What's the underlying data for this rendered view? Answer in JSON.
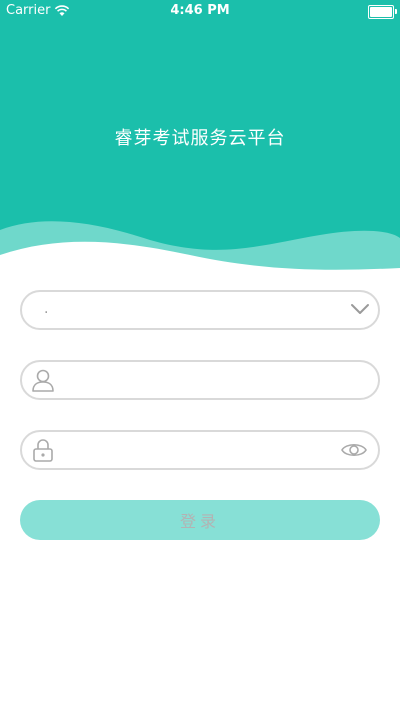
{
  "status_bar": {
    "carrier": "Carrier",
    "time": "4:46 PM"
  },
  "app": {
    "title": "睿芽考试服务云平台"
  },
  "form": {
    "school_select": {
      "value": "."
    },
    "username": {
      "value": ""
    },
    "password": {
      "value": ""
    },
    "login_label": "登录"
  },
  "colors": {
    "brand": "#1bbfab",
    "wave_light": "#6fd8cb",
    "button": "#87e0d6",
    "border": "#d9d9d9"
  }
}
